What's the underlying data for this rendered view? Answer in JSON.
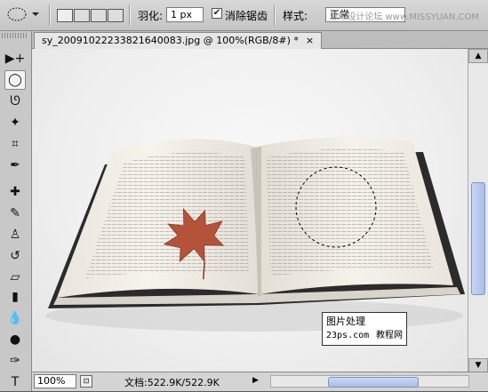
{
  "options_bar": {
    "feather_label": "羽化:",
    "feather_value": "1 px",
    "antialias_checked": true,
    "antialias_label": "消除锯齿",
    "style_label": "样式:",
    "style_value": "正常",
    "watermark": "思缘设计论坛 www.MISSYUAN.COM"
  },
  "document": {
    "tab_title": "sy_20091022233821640083.jpg @ 100%(RGB/8#) *",
    "tab_close": "×"
  },
  "status_bar": {
    "zoom": "100%",
    "doc_info": "文档:522.9K/522.9K"
  },
  "stamp": {
    "line1": "图片处理",
    "line2_left": "23ps.com",
    "line2_right": "教程网"
  },
  "tools": [
    {
      "name": "move-tool",
      "glyph": "▶+"
    },
    {
      "name": "elliptical-marquee-tool",
      "glyph": "◯"
    },
    {
      "name": "lasso-tool",
      "glyph": "ᘎ"
    },
    {
      "name": "magic-wand-tool",
      "glyph": "✦"
    },
    {
      "name": "crop-tool",
      "glyph": "⌗"
    },
    {
      "name": "eyedropper-tool",
      "glyph": "✒"
    },
    {
      "name": "healing-brush-tool",
      "glyph": "✚"
    },
    {
      "name": "brush-tool",
      "glyph": "✎"
    },
    {
      "name": "clone-stamp-tool",
      "glyph": "♙"
    },
    {
      "name": "history-brush-tool",
      "glyph": "↺"
    },
    {
      "name": "eraser-tool",
      "glyph": "▱"
    },
    {
      "name": "gradient-tool",
      "glyph": "▮"
    },
    {
      "name": "blur-tool",
      "glyph": "💧"
    },
    {
      "name": "dodge-tool",
      "glyph": "●"
    },
    {
      "name": "pen-tool",
      "glyph": "✑"
    },
    {
      "name": "type-tool",
      "glyph": "T"
    }
  ],
  "colors": {
    "scroll_accent": "#a9bde6"
  }
}
